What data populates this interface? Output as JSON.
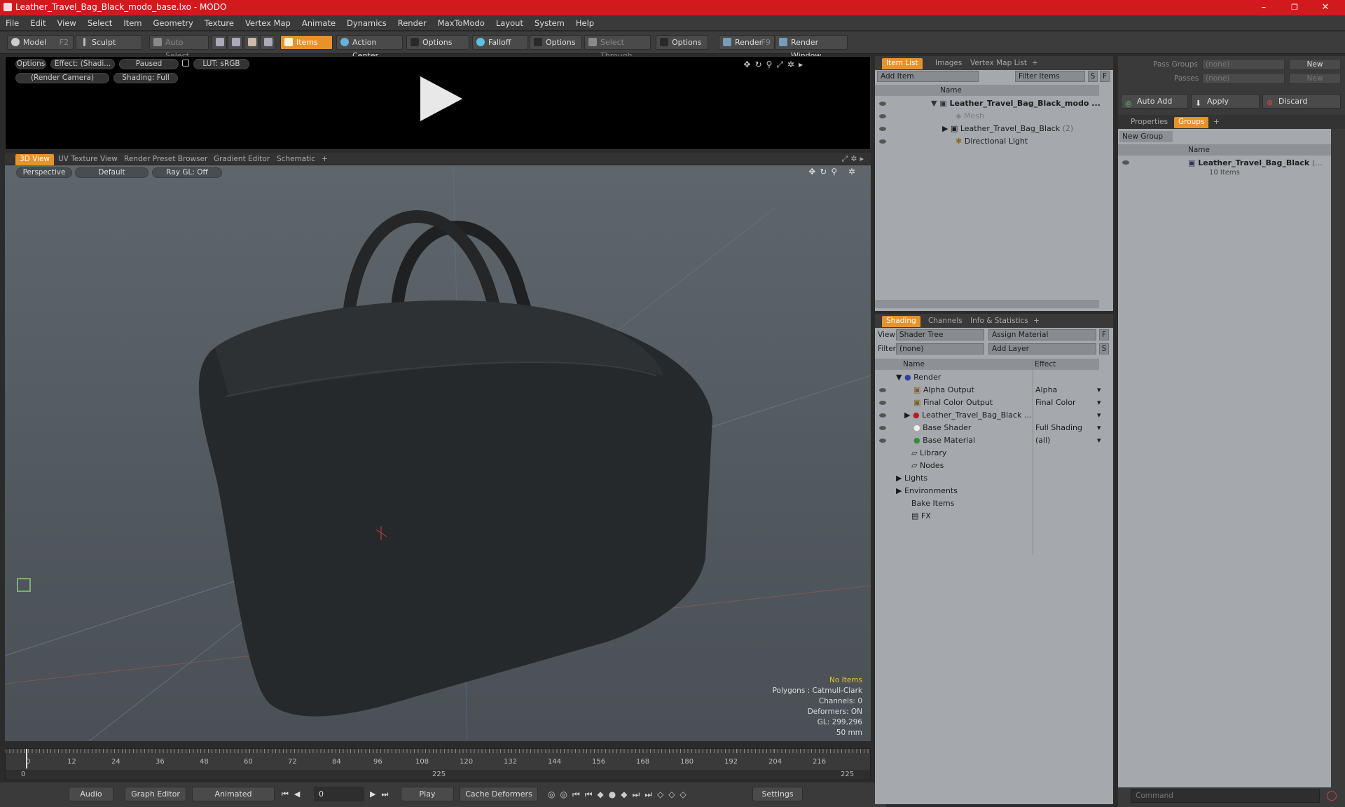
{
  "window": {
    "title": "Leather_Travel_Bag_Black_modo_base.lxo - MODO",
    "minimize": "–",
    "maximize": "❐",
    "close": "✕"
  },
  "menu": [
    "File",
    "Edit",
    "View",
    "Select",
    "Item",
    "Geometry",
    "Texture",
    "Vertex Map",
    "Animate",
    "Dynamics",
    "Render",
    "MaxToModo",
    "Layout",
    "System",
    "Help"
  ],
  "toolbar": {
    "model": "Model",
    "model_key": "F2",
    "sculpt": "Sculpt",
    "auto_select": "Auto Select",
    "items": "Items",
    "action_center": "Action Center",
    "options1": "Options",
    "falloff": "Falloff",
    "options2": "Options",
    "select_through": "Select Through",
    "options3": "Options",
    "render": "Render",
    "render_key": "F9",
    "render_window": "Render Window"
  },
  "preview": {
    "options": "Options",
    "effect": "Effect: (Shadi...",
    "paused": "Paused",
    "lut": "LUT: sRGB",
    "camera": "(Render Camera)",
    "shading": "Shading: Full"
  },
  "view_tabs": [
    "3D View",
    "UV Texture View",
    "Render Preset Browser",
    "Gradient Editor",
    "Schematic",
    "+"
  ],
  "viewport": {
    "perspective": "Perspective",
    "default": "Default",
    "raygl": "Ray GL: Off",
    "stats": {
      "no_items": "No Items",
      "polygons": "Polygons : Catmull-Clark",
      "channels": "Channels: 0",
      "deformers": "Deformers: ON",
      "gl": "GL: 299,296",
      "focal": "50 mm"
    }
  },
  "timeline": {
    "ticks": [
      "0",
      "12",
      "24",
      "36",
      "48",
      "60",
      "72",
      "84",
      "96",
      "108",
      "120",
      "132",
      "144",
      "156",
      "168",
      "180",
      "192",
      "204",
      "216"
    ],
    "range_start": "0",
    "range_mid": "225",
    "range_end": "225",
    "current_frame": 0,
    "total_frames": 225
  },
  "bottom": {
    "audio": "Audio",
    "graph_editor": "Graph Editor",
    "animated": "Animated",
    "frame": "0",
    "play": "Play",
    "cache": "Cache Deformers",
    "settings": "Settings",
    "command_placeholder": "Command"
  },
  "item_list": {
    "tabs": [
      "Item List",
      "Images",
      "Vertex Map List",
      "+"
    ],
    "add_item": "Add Item",
    "filter": "Filter Items",
    "s": "S",
    "f": "F",
    "col_name": "Name",
    "items": [
      {
        "label": "Leather_Travel_Bag_Black_modo ...",
        "bold": true
      },
      {
        "label": "Mesh",
        "dim": true
      },
      {
        "label": "Leather_Travel_Bag_Black",
        "extra": "(2)"
      },
      {
        "label": "Directional Light"
      }
    ]
  },
  "shading": {
    "tabs": [
      "Shading",
      "Channels",
      "Info & Statistics",
      "+"
    ],
    "view_label": "View",
    "view_value": "Shader Tree",
    "assign": "Assign Material",
    "f": "F",
    "filter_label": "Filter",
    "filter_value": "(none)",
    "add_layer": "Add Layer",
    "s": "S",
    "col_name": "Name",
    "col_effect": "Effect",
    "rows": [
      {
        "name": "Render",
        "effect": ""
      },
      {
        "name": "Alpha Output",
        "effect": "Alpha"
      },
      {
        "name": "Final Color Output",
        "effect": "Final Color"
      },
      {
        "name": "Leather_Travel_Bag_Black ...",
        "effect": ""
      },
      {
        "name": "Base Shader",
        "effect": "Full Shading"
      },
      {
        "name": "Base Material",
        "effect": "(all)"
      },
      {
        "name": "Library",
        "effect": ""
      },
      {
        "name": "Nodes",
        "effect": ""
      },
      {
        "name": "Lights",
        "effect": ""
      },
      {
        "name": "Environments",
        "effect": ""
      },
      {
        "name": "Bake Items",
        "effect": ""
      },
      {
        "name": "FX",
        "effect": ""
      }
    ]
  },
  "groups": {
    "pass_groups": "Pass Groups",
    "passes": "Passes",
    "none1": "(none)",
    "none2": "(none)",
    "new1": "New",
    "new2": "New",
    "auto_add": "Auto Add",
    "apply": "Apply",
    "discard": "Discard",
    "tabs": [
      "Properties",
      "Groups",
      "+"
    ],
    "new_group": "New Group",
    "col_name": "Name",
    "group_name": "Leather_Travel_Bag_Black",
    "group_extra": "(...",
    "group_count": "10 Items"
  },
  "colors": {
    "accent": "#e8922a",
    "title": "#d2191e"
  }
}
